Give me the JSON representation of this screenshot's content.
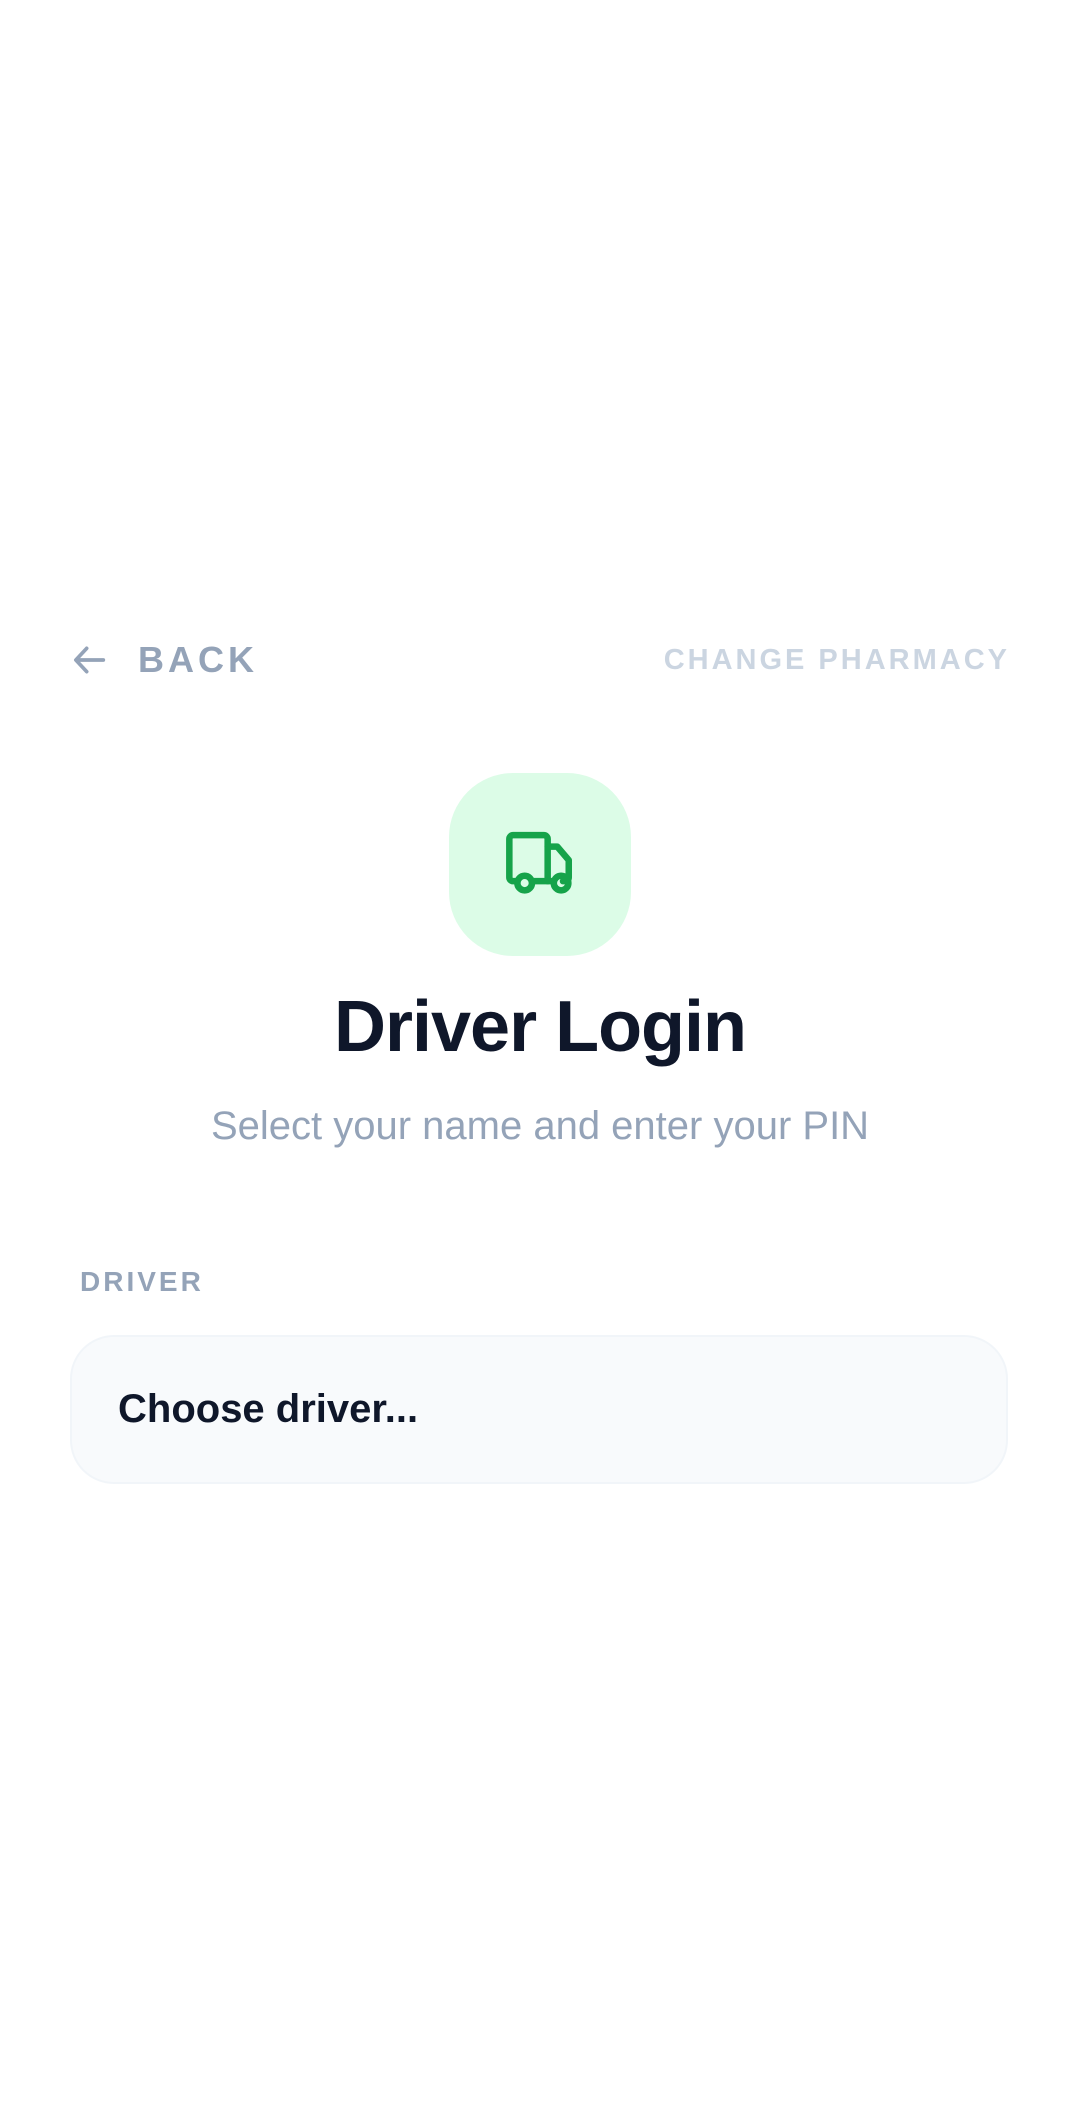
{
  "header": {
    "back_label": "BACK",
    "back_icon": "arrow-left-icon",
    "change_pharmacy_label": "CHANGE PHARMACY"
  },
  "hero": {
    "icon": "truck-icon",
    "icon_color": "#16a34a",
    "tile_color": "#dcfce7",
    "title": "Driver Login",
    "subtitle": "Select your name and enter your PIN"
  },
  "form": {
    "driver_label": "DRIVER",
    "driver_select": {
      "selected": "Choose driver..."
    }
  },
  "colors": {
    "title_text": "#0f172a",
    "muted_text": "#94a3b8",
    "faint_text": "#cbd5e1",
    "input_bg": "#f8fafc"
  }
}
